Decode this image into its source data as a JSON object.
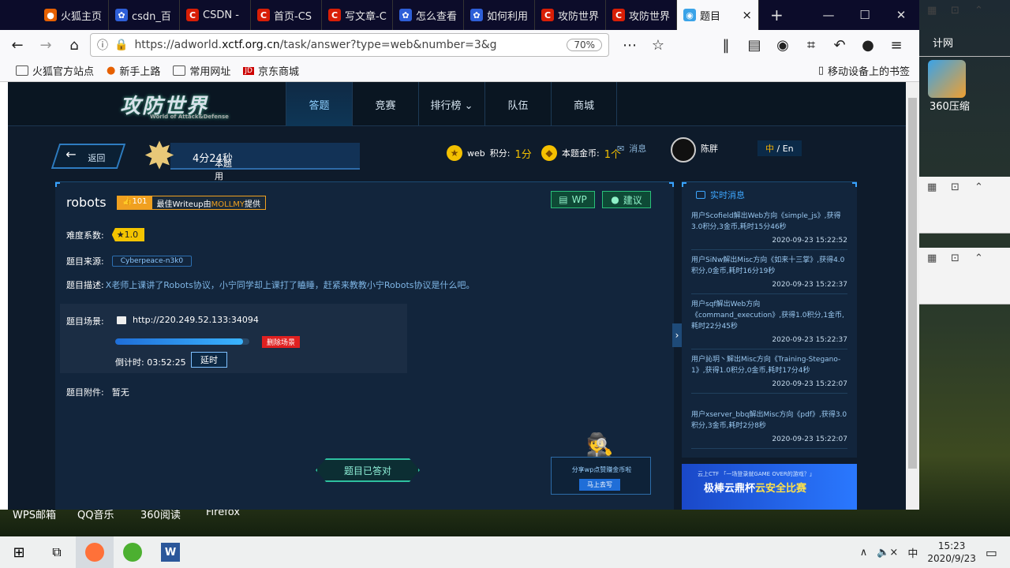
{
  "desktop": {
    "right_label": "计网",
    "icon_360_label": "360压缩",
    "bottom_icons": [
      "WPS邮箱",
      "QQ音乐",
      "360阅读",
      "Firefox"
    ]
  },
  "browser": {
    "tabs": [
      {
        "label": "火狐主页",
        "icon": "firefox-icon"
      },
      {
        "label": "csdn_百",
        "icon": "paw-icon"
      },
      {
        "label": "CSDN -",
        "icon": "csdn-icon"
      },
      {
        "label": "首页-CS",
        "icon": "csdn-icon"
      },
      {
        "label": "写文章-C",
        "icon": "csdn-icon"
      },
      {
        "label": "怎么查看",
        "icon": "paw-icon"
      },
      {
        "label": "如何利用",
        "icon": "paw-icon"
      },
      {
        "label": "攻防世界",
        "icon": "csdn-icon"
      },
      {
        "label": "攻防世界",
        "icon": "csdn-icon"
      }
    ],
    "active_tab": {
      "label": "题目",
      "close": "×"
    },
    "new_tab": "+",
    "url_prefix": "https://adworld.",
    "url_host": "xctf.org.cn",
    "url_rest": "/task/answer?type=web&number=3&g",
    "zoom": "70%",
    "bookmarks": [
      "火狐官方站点",
      "新手上路",
      "常用网址",
      "京东商城"
    ],
    "mobile_bookmarks": "移动设备上的书签"
  },
  "site": {
    "logo_text": "攻防世界",
    "logo_sub": "World of Attack&Defense",
    "nav": [
      "答题",
      "竞赛",
      "排行榜 ⌄",
      "队伍",
      "商城"
    ],
    "back_label": "返回",
    "timer_label": "本题用时:",
    "timer_value": "4分24秒",
    "web_label": "web",
    "score_label": "积分:",
    "score_value": "1分",
    "coins_label": "本题金币:",
    "coins_value": "1个",
    "messages": "消息",
    "username": "陈胖",
    "lang_zh": "中",
    "lang_en": " / En"
  },
  "task": {
    "title": "robots",
    "wu_count": "101",
    "wu_prefix": "最佳Writeup由",
    "wu_author": "MOLLMY",
    "wu_suffix": "提供",
    "wp_button": "WP",
    "suggest_button": "建议",
    "difficulty_label": "难度系数:",
    "difficulty_value": "★1.0",
    "source_label": "题目来源:",
    "source_value": "Cyberpeace-n3k0",
    "desc_label": "题目描述:",
    "desc_value": "X老师上课讲了Robots协议，小宁同学却上课打了瞌睡，赶紧来教教小宁Robots协议是什么吧。",
    "scene_label": "题目场景:",
    "scene_url": "http://220.249.52.133:34094",
    "delete_scene": "删除场景",
    "countdown_label": "倒计时:",
    "countdown_value": "03:52:25",
    "delay_button": "延时",
    "scene_progress": 0.95,
    "attachment_label": "题目附件:",
    "attachment_value": "暂无",
    "answered_button": "题目已答对",
    "share_text": "分享wp点赞赚金币啦",
    "share_button": "马上去写"
  },
  "news": {
    "title": "实时消息",
    "items": [
      {
        "text": "用户Scofield解出Web方向《simple_js》,获得3.0积分,3金币,耗时15分46秒",
        "time": "2020-09-23 15:22:52"
      },
      {
        "text": "用户SiNw解出Misc方向《如来十三掌》,获得4.0积分,0金币,耗时16分19秒",
        "time": "2020-09-23 15:22:37"
      },
      {
        "text": "用户sqf解出Web方向《command_execution》,获得1.0积分,1金币,耗时22分45秒",
        "time": "2020-09-23 15:22:37"
      },
      {
        "text": "用户訫玥丶解出Misc方向《Training-Stegano-1》,获得1.0积分,0金币,耗时17分4秒",
        "time": "2020-09-23 15:22:07"
      },
      {
        "text": "用户xserver_bbq解出Misc方向《pdf》,获得3.0积分,3金币,耗时2分8秒",
        "time": "2020-09-23 15:22:07"
      }
    ]
  },
  "ad": {
    "line1": "云上CTF 「一场登录就GAME OVER的游戏？」",
    "line2a": "极棒云鼎杯",
    "line2b": "云安全比赛"
  },
  "taskbar": {
    "time": "15:23",
    "date": "2020/9/23",
    "ime": "中",
    "volume": "🔈×",
    "up_arrow": "∧"
  }
}
